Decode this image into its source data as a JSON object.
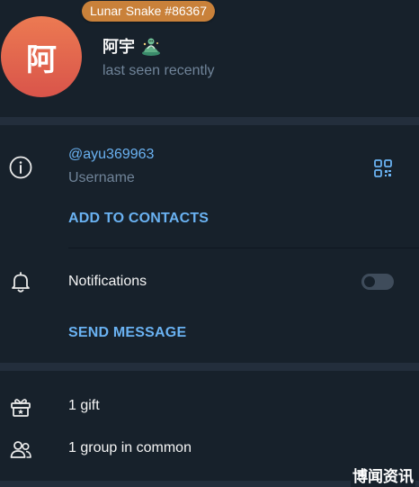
{
  "profile": {
    "avatar_initial": "阿",
    "badge": "Lunar Snake #86367",
    "name": "阿宇",
    "emoji_status_icon": "lunar-snake-icon",
    "status": "last seen recently"
  },
  "info": {
    "username": "@ayu369963",
    "username_label": "Username",
    "add_to_contacts": "ADD TO CONTACTS",
    "notifications_label": "Notifications",
    "notifications_enabled": false,
    "send_message": "SEND MESSAGE"
  },
  "extra": {
    "gifts": "1 gift",
    "groups": "1 group in common"
  },
  "watermark": "博闻资讯",
  "colors": {
    "background": "#17212b",
    "separator": "#232e3c",
    "accent": "#6ab2f2",
    "secondary_text": "#708499",
    "avatar": "#e2634c",
    "badge": "#c9813a"
  }
}
